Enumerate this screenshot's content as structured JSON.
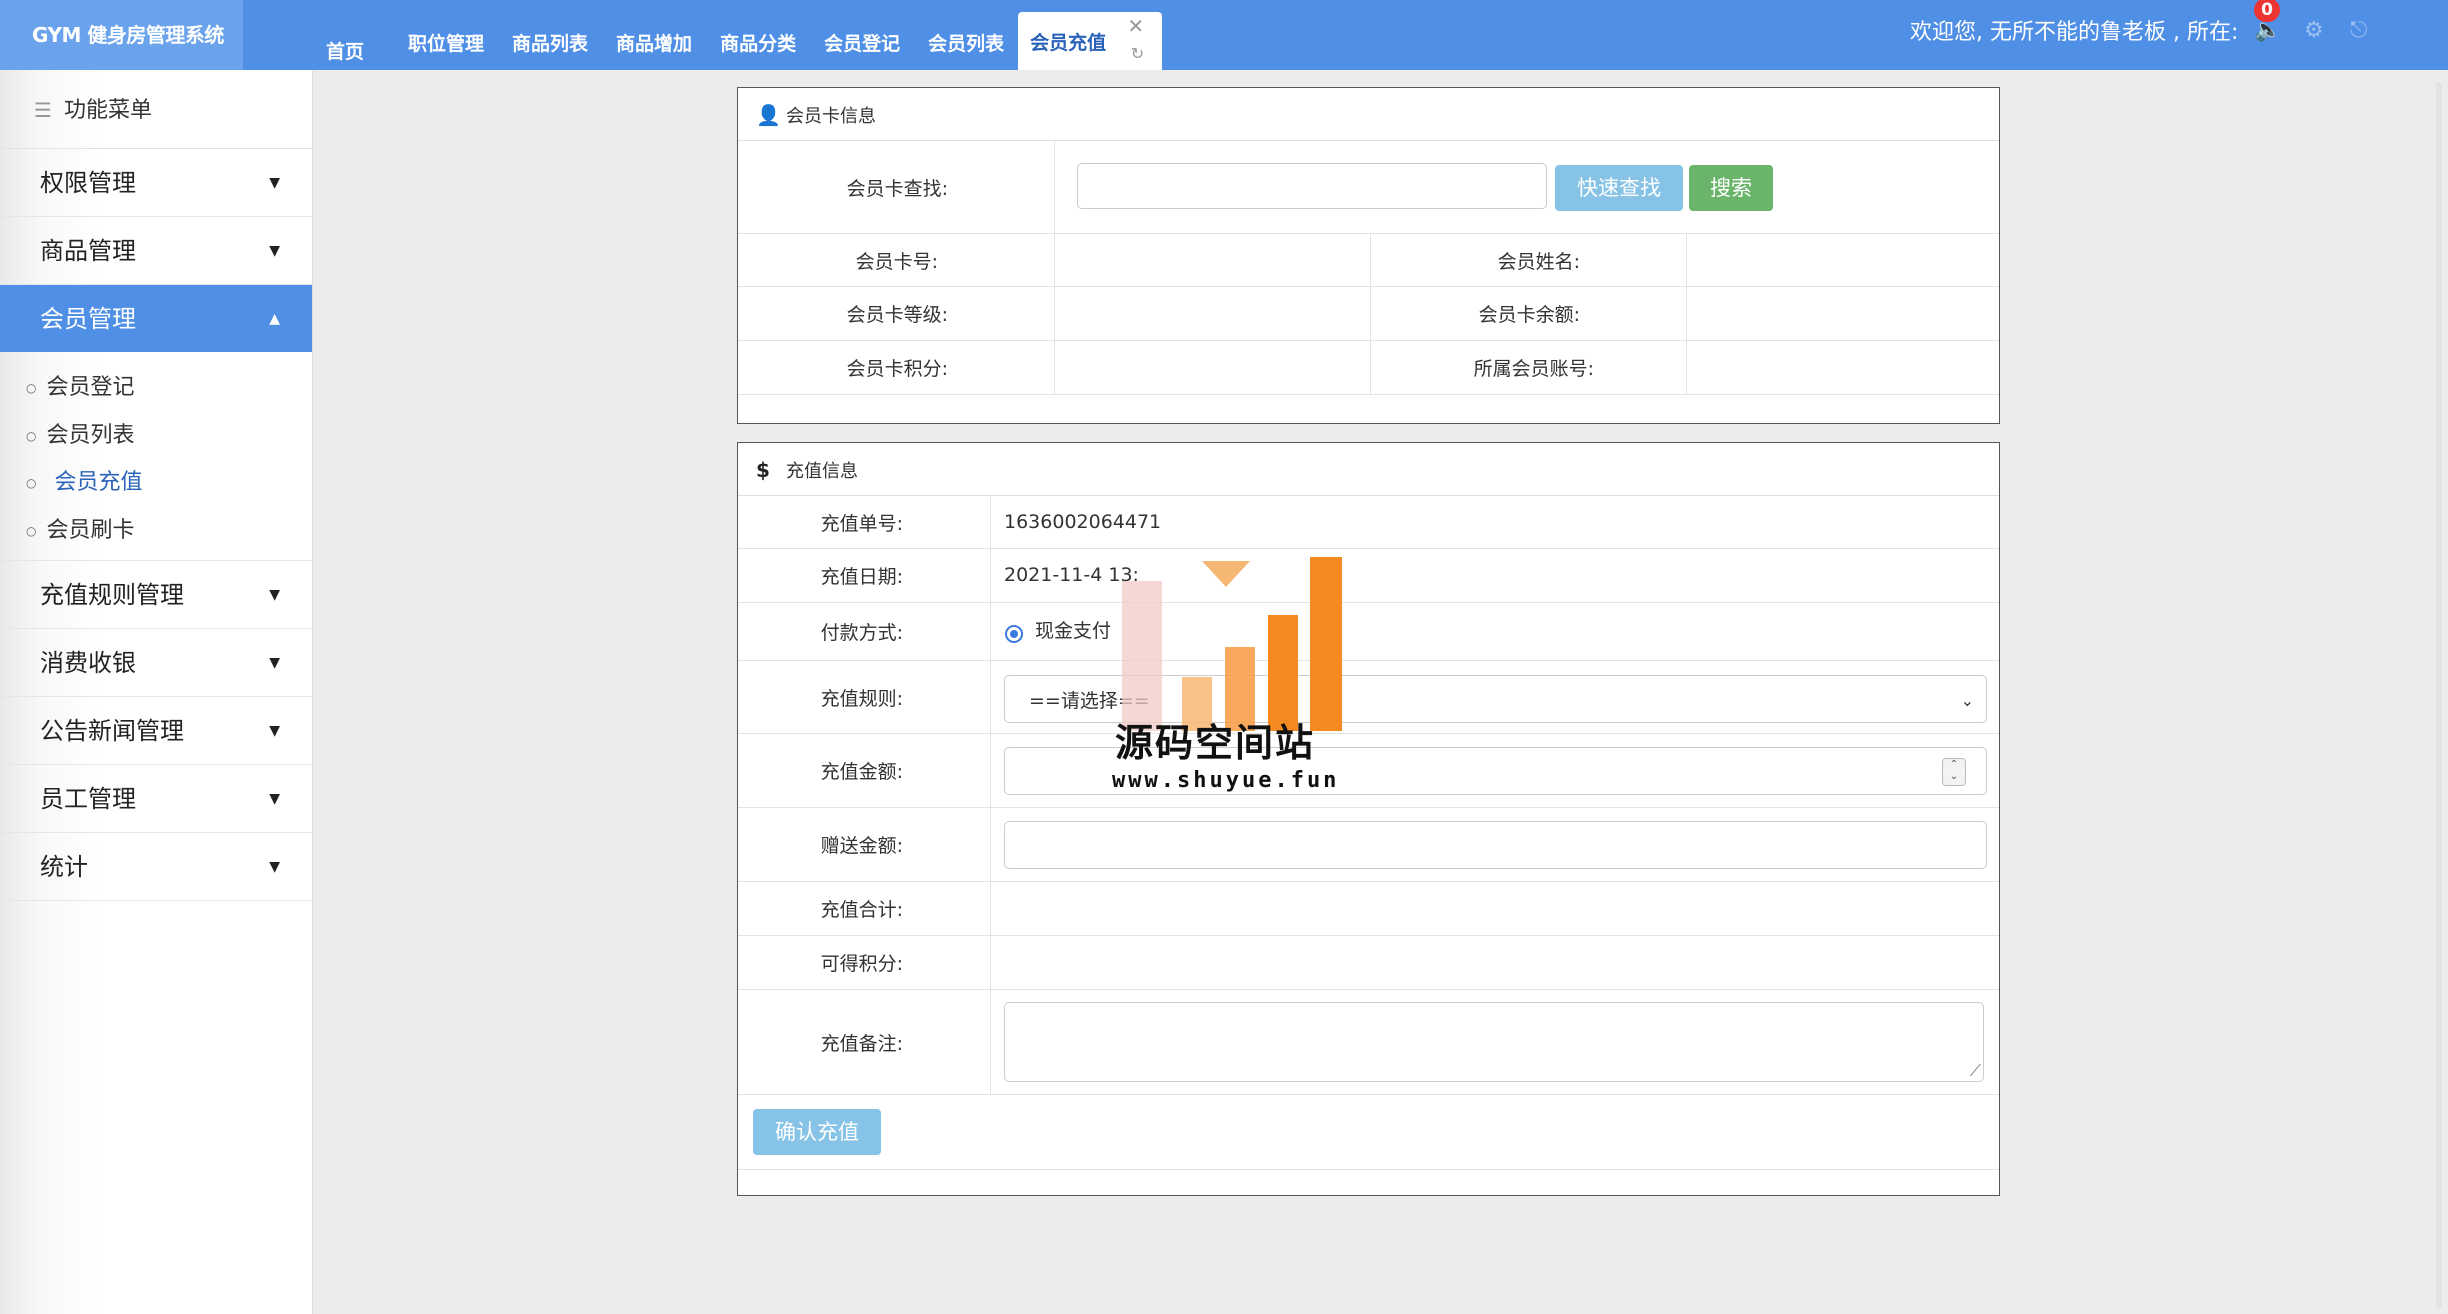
{
  "app": {
    "title": "GYM 健身房管理系统"
  },
  "tabs": [
    {
      "label": "首页"
    },
    {
      "label": "职位管理"
    },
    {
      "label": "商品列表"
    },
    {
      "label": "商品增加"
    },
    {
      "label": "商品分类"
    },
    {
      "label": "会员登记"
    },
    {
      "label": "会员列表"
    },
    {
      "label": "会员充值"
    }
  ],
  "header": {
    "welcome": "欢迎您, 无所不能的鲁老板 , 所在:",
    "notification_count": "0",
    "icons": [
      "volume-icon",
      "settings-icon",
      "logout-icon"
    ]
  },
  "sidebar": {
    "title": "功能菜单",
    "items": [
      {
        "label": "权限管理"
      },
      {
        "label": "商品管理"
      },
      {
        "label": "会员管理"
      },
      {
        "label": "充值规则管理"
      },
      {
        "label": "消费收银"
      },
      {
        "label": "公告新闻管理"
      },
      {
        "label": "员工管理"
      },
      {
        "label": "统计"
      }
    ],
    "sub_items": [
      {
        "label": "会员登记"
      },
      {
        "label": "会员列表"
      },
      {
        "label": "会员充值"
      },
      {
        "label": "会员刷卡"
      }
    ]
  },
  "card_panel": {
    "title": "会员卡信息",
    "search_label": "会员卡查找:",
    "search_value": "",
    "quick_button": "快速查找",
    "search_button": "搜索",
    "card_no_label": "会员卡号:",
    "name_label": "会员姓名:",
    "level_label": "会员卡等级:",
    "balance_label": "会员卡余额:",
    "points_label": "会员卡积分:",
    "account_label": "所属会员账号:"
  },
  "recharge_panel": {
    "title": "充值信息",
    "order_no_label": "充值单号:",
    "order_no": "1636002064471",
    "date_label": "充值日期:",
    "date": "2021-11-4 13:",
    "payment_label": "付款方式:",
    "payment_option": "现金支付",
    "rule_label": "充值规则:",
    "rule_selected": "==请选择==",
    "amount_label": "充值金额:",
    "amount_value": "",
    "gift_label": "赠送金额:",
    "gift_value": "",
    "total_label": "充值合计:",
    "points_label": "可得积分:",
    "note_label": "充值备注:",
    "note_value": "",
    "confirm_button": "确认充值"
  },
  "watermark": {
    "text": "源码空间站",
    "url": "www.shuyue.fun"
  }
}
